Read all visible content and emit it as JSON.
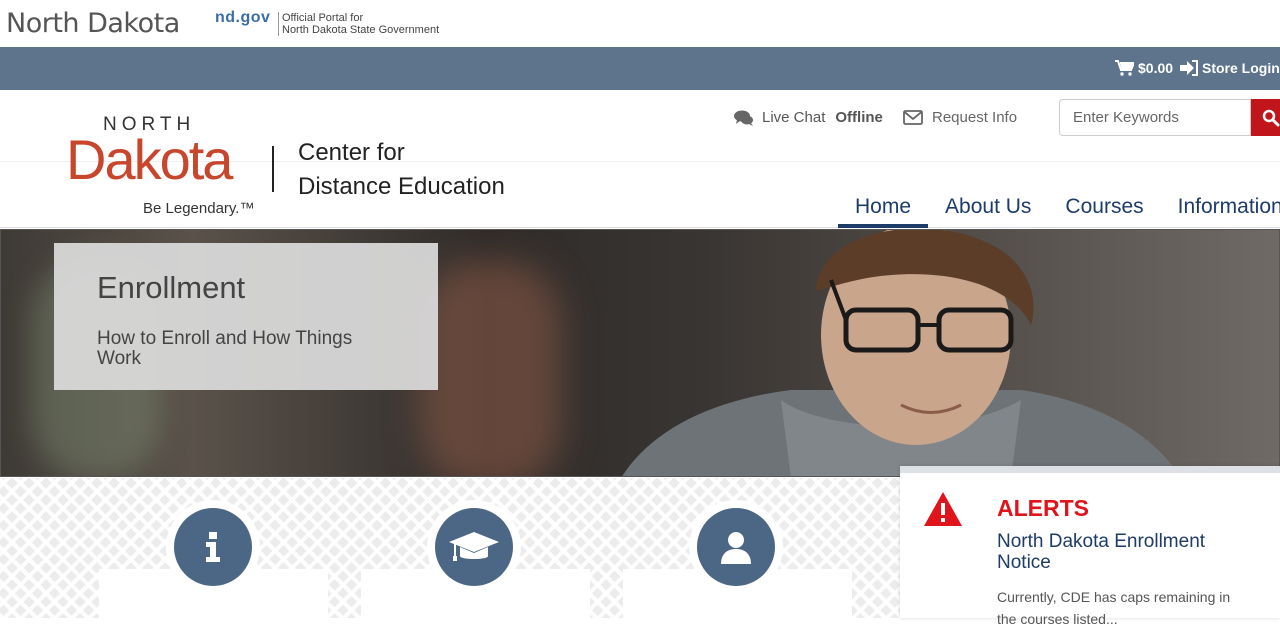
{
  "portal": {
    "state_name": "North Dakota",
    "ndgov": "nd.gov",
    "portal_line1": "Official Portal for",
    "portal_line2": "North Dakota State Government"
  },
  "store": {
    "cart_total": "$0.00",
    "login_label": "Store Login"
  },
  "logo": {
    "north": "NORTH",
    "dakota": "Dakota",
    "tagline": "Be Legendary.™",
    "org_line1": "Center for",
    "org_line2": "Distance Education"
  },
  "utility": {
    "live_chat_label": "Live Chat",
    "live_chat_status": "Offline",
    "request_info_label": "Request Info"
  },
  "search": {
    "placeholder": "Enter Keywords"
  },
  "nav": {
    "items": [
      {
        "label": "Home",
        "active": true
      },
      {
        "label": "About Us"
      },
      {
        "label": "Courses"
      },
      {
        "label": "Information"
      }
    ]
  },
  "hero": {
    "title": "Enrollment",
    "subtitle": "How to Enroll and How Things Work"
  },
  "alerts": {
    "heading": "ALERTS",
    "notice_title": "North Dakota Enrollment Notice",
    "body": "Currently, CDE has caps remaining in the courses listed..."
  },
  "colors": {
    "store_bar": "#5d748c",
    "nav_text": "#1d3c69",
    "brand_red": "#c8462b",
    "search_button": "#c0151b",
    "alert_red": "#e0141b",
    "circle_blue": "#4c6785"
  },
  "icons": {
    "cart": "shopping-cart-icon",
    "login": "sign-in-icon",
    "chat": "chat-bubbles-icon",
    "envelope": "envelope-icon",
    "search": "search-icon",
    "info": "info-icon",
    "graduation": "graduation-cap-icon",
    "user": "user-icon",
    "warning": "warning-triangle-icon"
  }
}
